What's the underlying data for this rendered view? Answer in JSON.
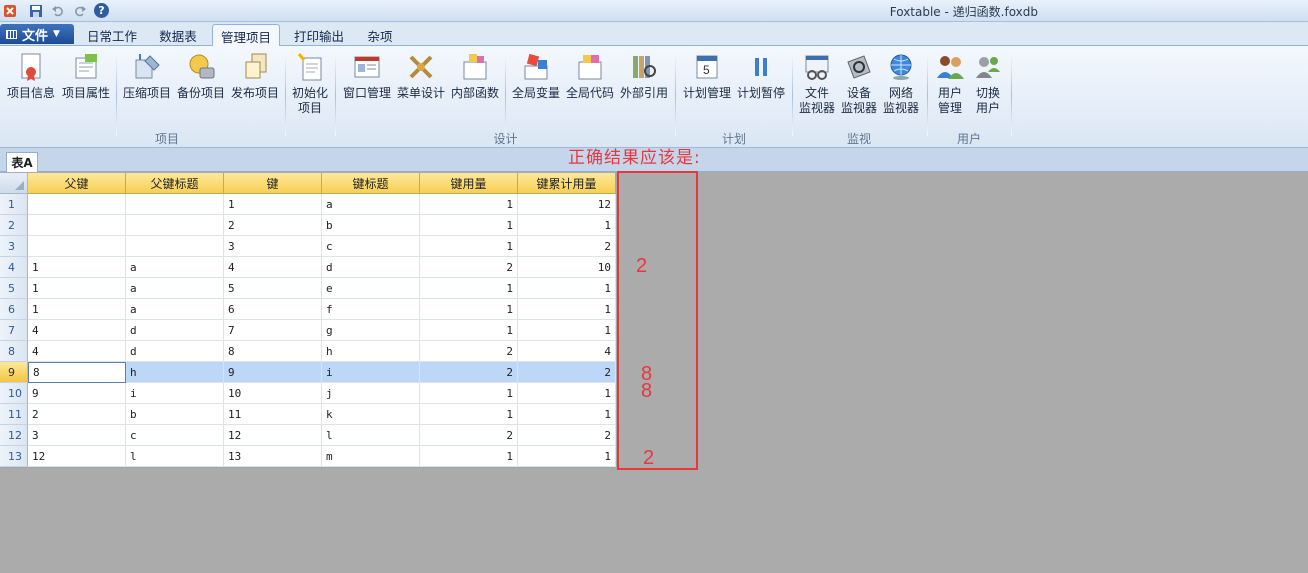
{
  "window": {
    "title": "Foxtable - 递归函数.foxdb"
  },
  "quick_access": {
    "help_label": "?"
  },
  "menu": {
    "file_label": "文件",
    "tabs": [
      {
        "label": "日常工作"
      },
      {
        "label": "数据表"
      },
      {
        "label": "管理项目",
        "active": true
      },
      {
        "label": "打印输出"
      },
      {
        "label": "杂项"
      }
    ]
  },
  "ribbon": {
    "buttons": [
      {
        "label": "项目信息",
        "icon": "project-info-icon"
      },
      {
        "label": "项目属性",
        "icon": "project-properties-icon"
      },
      {
        "label": "压缩项目",
        "icon": "compress-project-icon"
      },
      {
        "label": "备份项目",
        "icon": "backup-project-icon"
      },
      {
        "label": "发布项目",
        "icon": "publish-project-icon"
      },
      {
        "label": "初始化\n项目",
        "icon": "init-project-icon"
      },
      {
        "label": "窗口管理",
        "icon": "window-manager-icon"
      },
      {
        "label": "菜单设计",
        "icon": "menu-design-icon"
      },
      {
        "label": "内部函数",
        "icon": "internal-function-icon"
      },
      {
        "label": "全局变量",
        "icon": "global-variable-icon"
      },
      {
        "label": "全局代码",
        "icon": "global-code-icon"
      },
      {
        "label": "外部引用",
        "icon": "external-reference-icon"
      },
      {
        "label": "计划管理",
        "icon": "schedule-manager-icon"
      },
      {
        "label": "计划暂停",
        "icon": "pause-schedule-icon"
      },
      {
        "label": "文件\n监视器",
        "icon": "file-monitor-icon"
      },
      {
        "label": "设备\n监视器",
        "icon": "device-monitor-icon"
      },
      {
        "label": "网络\n监视器",
        "icon": "network-monitor-icon"
      },
      {
        "label": "用户\n管理",
        "icon": "user-manager-icon"
      },
      {
        "label": "切换\n用户",
        "icon": "switch-user-icon"
      }
    ],
    "groups": [
      {
        "label": "项目"
      },
      {
        "label": "设计"
      },
      {
        "label": "计划"
      },
      {
        "label": "监视"
      },
      {
        "label": "用户"
      }
    ]
  },
  "sheet": {
    "tab_label": "表A"
  },
  "table": {
    "columns": [
      "父键",
      "父键标题",
      "键",
      "键标题",
      "键用量",
      "键累计用量"
    ],
    "rows": [
      [
        "",
        "",
        "1",
        "a",
        "1",
        "12"
      ],
      [
        "",
        "",
        "2",
        "b",
        "1",
        "1"
      ],
      [
        "",
        "",
        "3",
        "c",
        "1",
        "2"
      ],
      [
        "1",
        "a",
        "4",
        "d",
        "2",
        "10"
      ],
      [
        "1",
        "a",
        "5",
        "e",
        "1",
        "1"
      ],
      [
        "1",
        "a",
        "6",
        "f",
        "1",
        "1"
      ],
      [
        "4",
        "d",
        "7",
        "g",
        "1",
        "1"
      ],
      [
        "4",
        "d",
        "8",
        "h",
        "2",
        "4"
      ],
      [
        "8",
        "h",
        "9",
        "i",
        "2",
        "2"
      ],
      [
        "9",
        "i",
        "10",
        "j",
        "1",
        "1"
      ],
      [
        "2",
        "b",
        "11",
        "k",
        "1",
        "1"
      ],
      [
        "3",
        "c",
        "12",
        "l",
        "2",
        "2"
      ],
      [
        "12",
        "l",
        "13",
        "m",
        "1",
        "1"
      ]
    ],
    "selected_row": 9
  },
  "annotation": {
    "title": "正确结果应该是:",
    "values": [
      "2",
      "8",
      "8",
      "2"
    ],
    "color": "#e8373d"
  }
}
